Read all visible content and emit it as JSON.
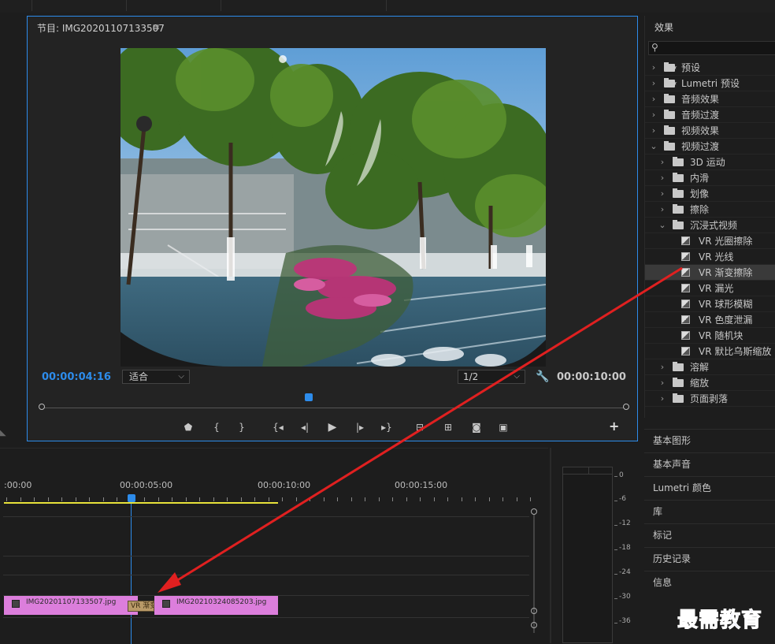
{
  "program_monitor": {
    "title": "节目: IMG20201107133507",
    "menu_icon": "hamburger-icon",
    "current_timecode": "00:00:04:16",
    "duration_timecode": "00:00:10:00",
    "fit_value": "适合",
    "resolution_value": "1/2",
    "transport": {
      "marker": "add-marker-icon",
      "mark_in": "mark-in-icon",
      "mark_out": "mark-out-icon",
      "go_to_in": "go-to-in-icon",
      "step_back": "step-back-icon",
      "play": "play-icon",
      "step_forward": "step-forward-icon",
      "go_to_out": "go-to-out-icon",
      "lift": "lift-icon",
      "extract": "extract-icon",
      "export_frame": "camera-icon",
      "compare": "compare-icon",
      "add": "+"
    }
  },
  "effects_panel": {
    "title": "效果",
    "search_placeholder": "",
    "items": [
      {
        "label": "预设",
        "level": 0,
        "kind": "folder-star",
        "expanded": false
      },
      {
        "label": "Lumetri 预设",
        "level": 0,
        "kind": "folder-star",
        "expanded": false
      },
      {
        "label": "音频效果",
        "level": 0,
        "kind": "folder",
        "expanded": false
      },
      {
        "label": "音频过渡",
        "level": 0,
        "kind": "folder",
        "expanded": false
      },
      {
        "label": "视频效果",
        "level": 0,
        "kind": "folder",
        "expanded": false
      },
      {
        "label": "视频过渡",
        "level": 0,
        "kind": "folder",
        "expanded": true
      },
      {
        "label": "3D 运动",
        "level": 1,
        "kind": "folder",
        "expanded": false
      },
      {
        "label": "内滑",
        "level": 1,
        "kind": "folder",
        "expanded": false
      },
      {
        "label": "划像",
        "level": 1,
        "kind": "folder",
        "expanded": false
      },
      {
        "label": "擦除",
        "level": 1,
        "kind": "folder",
        "expanded": false
      },
      {
        "label": "沉浸式视频",
        "level": 1,
        "kind": "folder",
        "expanded": true
      },
      {
        "label": "VR 光圈擦除",
        "level": 2,
        "kind": "effect"
      },
      {
        "label": "VR 光线",
        "level": 2,
        "kind": "effect"
      },
      {
        "label": "VR 渐变擦除",
        "level": 2,
        "kind": "effect",
        "selected": true
      },
      {
        "label": "VR 漏光",
        "level": 2,
        "kind": "effect"
      },
      {
        "label": "VR 球形模糊",
        "level": 2,
        "kind": "effect"
      },
      {
        "label": "VR 色度泄漏",
        "level": 2,
        "kind": "effect"
      },
      {
        "label": "VR 随机块",
        "level": 2,
        "kind": "effect"
      },
      {
        "label": "VR 默比乌斯缩放",
        "level": 2,
        "kind": "effect"
      },
      {
        "label": "溶解",
        "level": 1,
        "kind": "folder",
        "expanded": false
      },
      {
        "label": "缩放",
        "level": 1,
        "kind": "folder",
        "expanded": false
      },
      {
        "label": "页面剥落",
        "level": 1,
        "kind": "folder",
        "expanded": false
      }
    ]
  },
  "side_panels": [
    "基本图形",
    "基本声音",
    "Lumetri 颜色",
    "库",
    "标记",
    "历史记录",
    "信息"
  ],
  "timeline": {
    "ruler": [
      ":00:00",
      "00:00:05:00",
      "00:00:10:00",
      "00:00:15:00"
    ],
    "clip1": "IMG20201107133507.jpg",
    "clip2": "IMG20210324085203.jpg",
    "transition_label": "VR 渐变"
  },
  "audio_meter": {
    "labels": [
      "0",
      "-6",
      "-12",
      "-18",
      "-24",
      "-30",
      "-36"
    ]
  },
  "watermark": "最需教育",
  "colors": {
    "accent_blue": "#2d8ceb",
    "clip_pink": "#dc7edc",
    "work_area_yellow": "#e7e23a",
    "annotation_red": "#e02020",
    "watermark_blue": "#2b39c8"
  }
}
